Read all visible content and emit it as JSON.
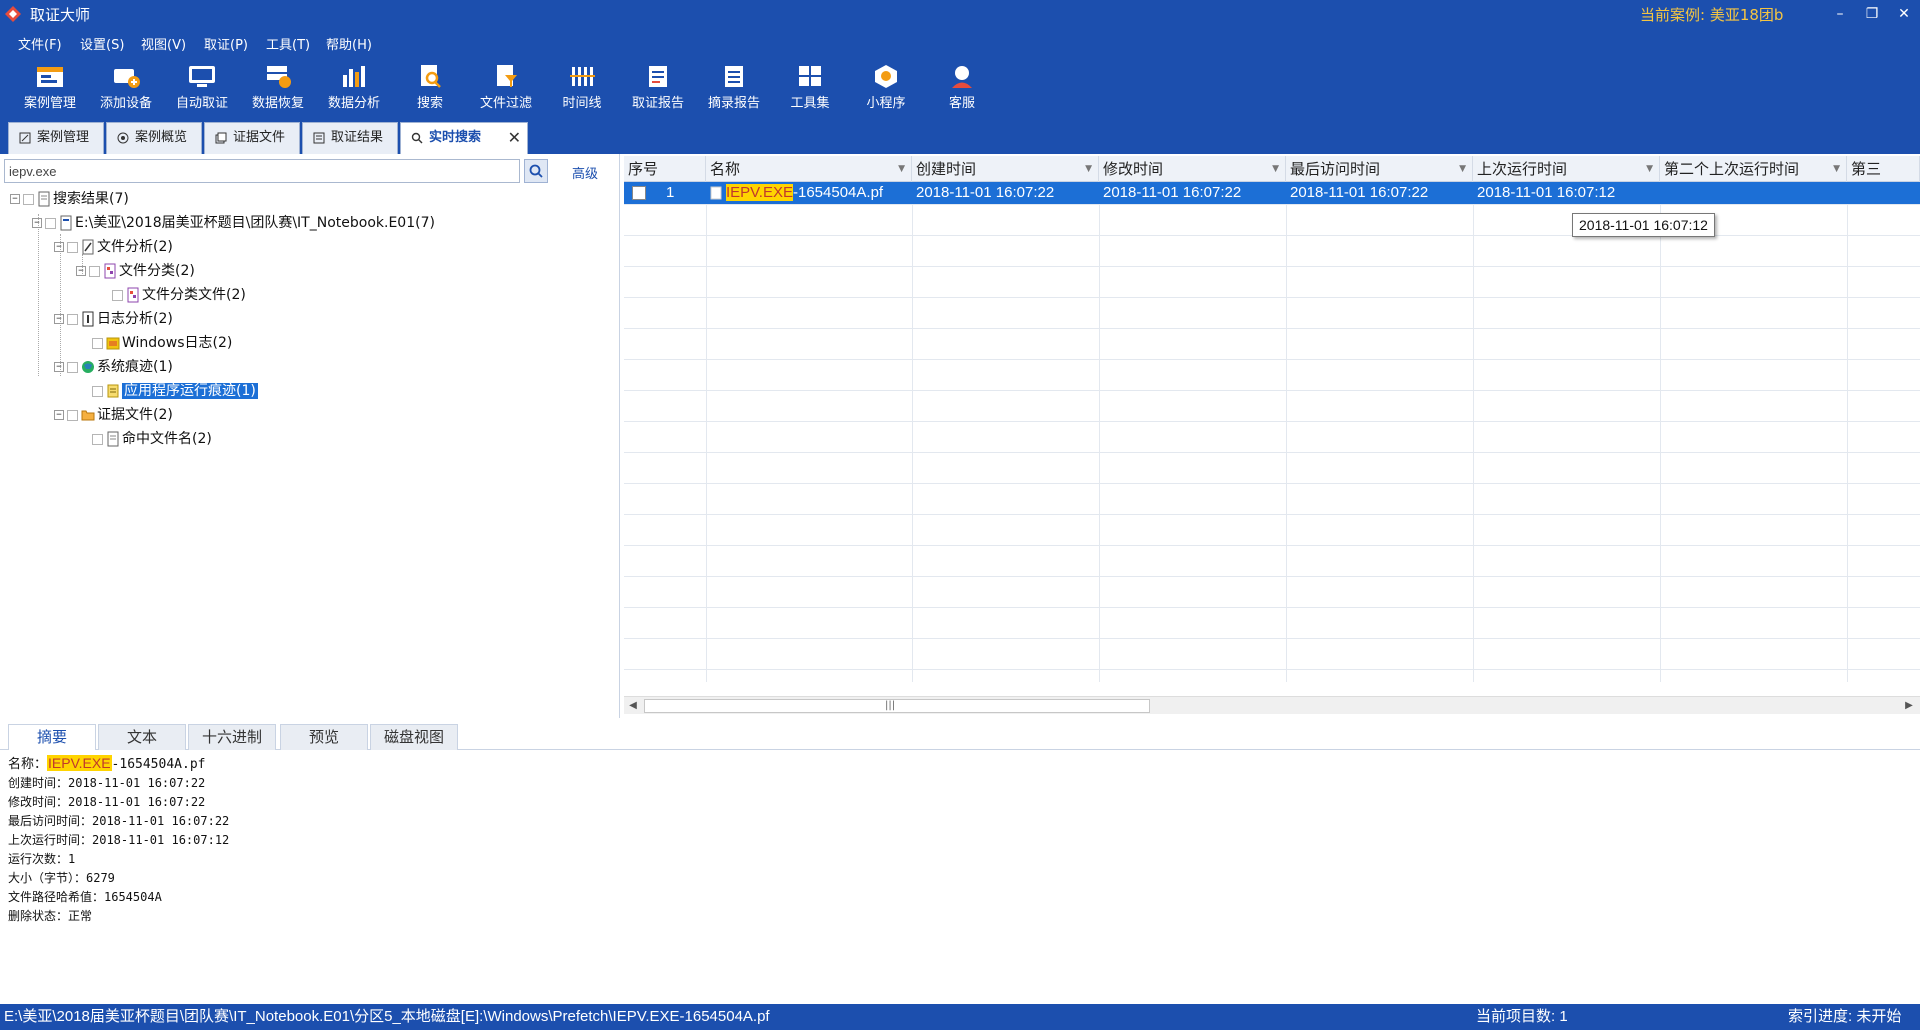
{
  "titlebar": {
    "app_title": "取证大师",
    "case_label": "当前案例: 美亚18团b",
    "minimize": "–",
    "restore": "❐",
    "close": "✕"
  },
  "menu": [
    "文件(F)",
    "设置(S)",
    "视图(V)",
    "取证(P)",
    "工具(T)",
    "帮助(H)"
  ],
  "toolbar": [
    {
      "label": "案例管理",
      "icon": "case-manage-icon"
    },
    {
      "label": "添加设备",
      "icon": "add-device-icon"
    },
    {
      "label": "自动取证",
      "icon": "auto-forensics-icon"
    },
    {
      "label": "数据恢复",
      "icon": "data-recovery-icon"
    },
    {
      "label": "数据分析",
      "icon": "data-analysis-icon"
    },
    {
      "label": "搜索",
      "icon": "search-icon"
    },
    {
      "label": "文件过滤",
      "icon": "file-filter-icon"
    },
    {
      "label": "时间线",
      "icon": "timeline-icon"
    },
    {
      "label": "取证报告",
      "icon": "forensic-report-icon"
    },
    {
      "label": "摘录报告",
      "icon": "excerpt-report-icon"
    },
    {
      "label": "工具集",
      "icon": "toolset-icon"
    },
    {
      "label": "小程序",
      "icon": "mini-program-icon"
    },
    {
      "label": "客服",
      "icon": "customer-service-icon"
    }
  ],
  "tabs": [
    {
      "label": "案例管理"
    },
    {
      "label": "案例概览"
    },
    {
      "label": "证据文件"
    },
    {
      "label": "取证结果"
    },
    {
      "label": "实时搜索"
    }
  ],
  "search": {
    "value": "iepv.exe",
    "advanced": "高级"
  },
  "tree": [
    {
      "label": "搜索结果(7)"
    },
    {
      "label": "E:\\美亚\\2018届美亚杯题目\\团队赛\\IT_Notebook.E01(7)"
    },
    {
      "label": "文件分析(2)"
    },
    {
      "label": "文件分类(2)"
    },
    {
      "label": "文件分类文件(2)"
    },
    {
      "label": "日志分析(2)"
    },
    {
      "label": "Windows日志(2)"
    },
    {
      "label": "系统痕迹(1)"
    },
    {
      "label": "应用程序运行痕迹(1)"
    },
    {
      "label": "证据文件(2)"
    },
    {
      "label": "命中文件名(2)"
    }
  ],
  "grid": {
    "columns": [
      "序号",
      "名称",
      "创建时间",
      "修改时间",
      "最后访问时间",
      "上次运行时间",
      "第二个上次运行时间",
      "第三"
    ],
    "row": {
      "index": "1",
      "name_highlight": "IEPV.EXE",
      "name_rest": "-1654504A.pf",
      "created": "2018-11-01 16:07:22",
      "modified": "2018-11-01 16:07:22",
      "accessed": "2018-11-01 16:07:22",
      "last_run": "2018-11-01 16:07:12"
    },
    "tooltip": "2018-11-01 16:07:12"
  },
  "bottom_tabs": [
    "摘要",
    "文本",
    "十六进制",
    "预览",
    "磁盘视图"
  ],
  "summary": {
    "name_label": "名称：",
    "name_highlight": "IEPV.EXE",
    "name_rest": "-1654504A.pf",
    "lines": [
      "创建时间：2018-11-01 16:07:22",
      "修改时间：2018-11-01 16:07:22",
      "最后访问时间：2018-11-01 16:07:22",
      "上次运行时间：2018-11-01 16:07:12",
      "运行次数：1",
      "大小（字节）：6279",
      "文件路径哈希值：1654504A",
      "删除状态：正常"
    ]
  },
  "status": {
    "path": "E:\\美亚\\2018届美亚杯题目\\团队赛\\IT_Notebook.E01\\分区5_本地磁盘[E]:\\Windows\\Prefetch\\IEPV.EXE-1654504A.pf",
    "count": "当前项目数: 1",
    "index": "索引进度: 未开始"
  },
  "colors": {
    "chrome": "#1c4fae",
    "selection": "#1c6fd6",
    "highlight": "#ffd400",
    "case_label": "#f5c542"
  }
}
